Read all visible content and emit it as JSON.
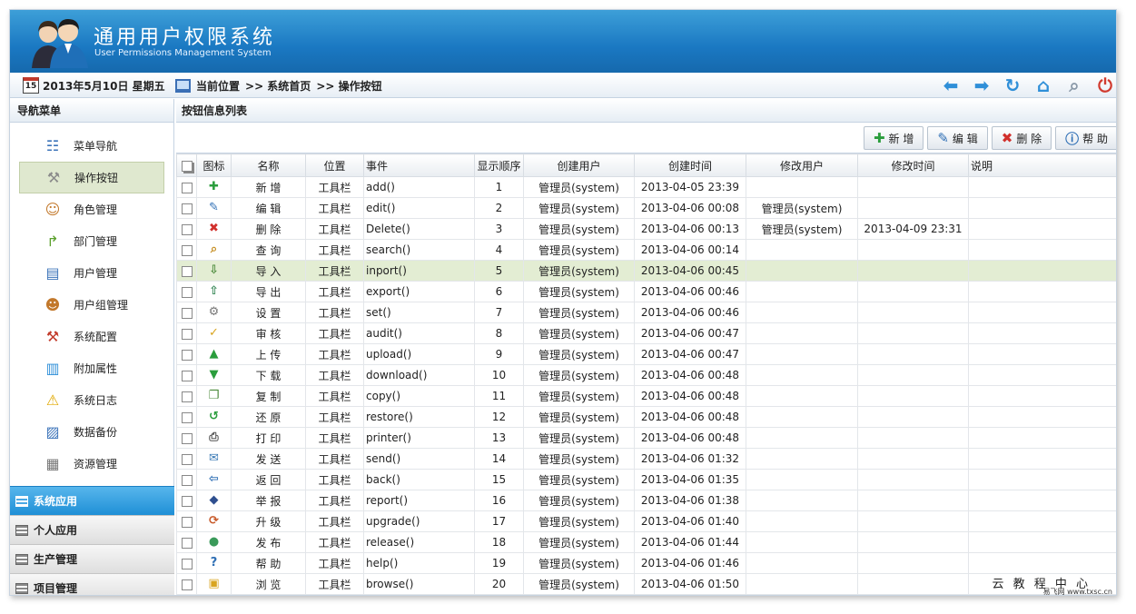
{
  "header": {
    "title": "通用用户权限系统",
    "subtitle": "User Permissions Management System"
  },
  "topbar": {
    "calendar_day": "15",
    "date": "2013年5月10日 星期五",
    "location_label": "当前位置",
    "crumb1": ">> 系统首页",
    "crumb2": ">> 操作按钮"
  },
  "sidebar": {
    "title": "导航菜单",
    "items": [
      {
        "label": "菜单导航",
        "icon": "sitemap-icon"
      },
      {
        "label": "操作按钮",
        "icon": "wrench-icon"
      },
      {
        "label": "角色管理",
        "icon": "users-icon"
      },
      {
        "label": "部门管理",
        "icon": "branch-icon"
      },
      {
        "label": "用户管理",
        "icon": "id-card-icon"
      },
      {
        "label": "用户组管理",
        "icon": "user-group-icon"
      },
      {
        "label": "系统配置",
        "icon": "tools-icon"
      },
      {
        "label": "附加属性",
        "icon": "book-icon"
      },
      {
        "label": "系统日志",
        "icon": "warning-icon"
      },
      {
        "label": "数据备份",
        "icon": "backup-icon"
      },
      {
        "label": "资源管理",
        "icon": "database-icon"
      }
    ],
    "groups": [
      "系统应用",
      "个人应用",
      "生产管理",
      "项目管理"
    ]
  },
  "main": {
    "title": "按钮信息列表",
    "buttons": {
      "add": "新 增",
      "edit": "编 辑",
      "delete": "删 除",
      "help": "帮 助"
    },
    "columns": [
      "图标",
      "名称",
      "位置",
      "事件",
      "显示顺序",
      "创建用户",
      "创建时间",
      "修改用户",
      "修改时间",
      "说明"
    ],
    "rows": [
      {
        "icon": "plus-icon",
        "name": "新 增",
        "pos": "工具栏",
        "event": "add()",
        "order": "1",
        "creator": "管理员(system)",
        "created": "2013-04-05 23:39",
        "modifier": "",
        "modified": ""
      },
      {
        "icon": "pencil-icon",
        "name": "编 辑",
        "pos": "工具栏",
        "event": "edit()",
        "order": "2",
        "creator": "管理员(system)",
        "created": "2013-04-06 00:08",
        "modifier": "管理员(system)",
        "modified": ""
      },
      {
        "icon": "cross-icon",
        "name": "删 除",
        "pos": "工具栏",
        "event": "Delete()",
        "order": "3",
        "creator": "管理员(system)",
        "created": "2013-04-06 00:13",
        "modifier": "管理员(system)",
        "modified": "2013-04-09 23:31"
      },
      {
        "icon": "magnifier-icon",
        "name": "查 询",
        "pos": "工具栏",
        "event": "search()",
        "order": "4",
        "creator": "管理员(system)",
        "created": "2013-04-06 00:14",
        "modifier": "",
        "modified": ""
      },
      {
        "icon": "import-icon",
        "name": "导 入",
        "pos": "工具栏",
        "event": "inport()",
        "order": "5",
        "creator": "管理员(system)",
        "created": "2013-04-06 00:45",
        "modifier": "",
        "modified": ""
      },
      {
        "icon": "export-icon",
        "name": "导 出",
        "pos": "工具栏",
        "event": "export()",
        "order": "6",
        "creator": "管理员(system)",
        "created": "2013-04-06 00:46",
        "modifier": "",
        "modified": ""
      },
      {
        "icon": "gear-icon",
        "name": "设 置",
        "pos": "工具栏",
        "event": "set()",
        "order": "7",
        "creator": "管理员(system)",
        "created": "2013-04-06 00:46",
        "modifier": "",
        "modified": ""
      },
      {
        "icon": "folder-check-icon",
        "name": "审 核",
        "pos": "工具栏",
        "event": "audit()",
        "order": "8",
        "creator": "管理员(system)",
        "created": "2013-04-06 00:47",
        "modifier": "",
        "modified": ""
      },
      {
        "icon": "upload-icon",
        "name": "上 传",
        "pos": "工具栏",
        "event": "upload()",
        "order": "9",
        "creator": "管理员(system)",
        "created": "2013-04-06 00:47",
        "modifier": "",
        "modified": ""
      },
      {
        "icon": "download-icon",
        "name": "下 载",
        "pos": "工具栏",
        "event": "download()",
        "order": "10",
        "creator": "管理员(system)",
        "created": "2013-04-06 00:48",
        "modifier": "",
        "modified": ""
      },
      {
        "icon": "copy-icon",
        "name": "复 制",
        "pos": "工具栏",
        "event": "copy()",
        "order": "11",
        "creator": "管理员(system)",
        "created": "2013-04-06 00:48",
        "modifier": "",
        "modified": ""
      },
      {
        "icon": "restore-icon",
        "name": "还 原",
        "pos": "工具栏",
        "event": "restore()",
        "order": "12",
        "creator": "管理员(system)",
        "created": "2013-04-06 00:48",
        "modifier": "",
        "modified": ""
      },
      {
        "icon": "printer-icon",
        "name": "打 印",
        "pos": "工具栏",
        "event": "printer()",
        "order": "13",
        "creator": "管理员(system)",
        "created": "2013-04-06 00:48",
        "modifier": "",
        "modified": ""
      },
      {
        "icon": "mail-icon",
        "name": "发 送",
        "pos": "工具栏",
        "event": "send()",
        "order": "14",
        "creator": "管理员(system)",
        "created": "2013-04-06 01:32",
        "modifier": "",
        "modified": ""
      },
      {
        "icon": "back-arrow-icon",
        "name": "返 回",
        "pos": "工具栏",
        "event": "back()",
        "order": "15",
        "creator": "管理员(system)",
        "created": "2013-04-06 01:35",
        "modifier": "",
        "modified": ""
      },
      {
        "icon": "report-icon",
        "name": "举 报",
        "pos": "工具栏",
        "event": "report()",
        "order": "16",
        "creator": "管理员(system)",
        "created": "2013-04-06 01:38",
        "modifier": "",
        "modified": ""
      },
      {
        "icon": "upgrade-icon",
        "name": "升 级",
        "pos": "工具栏",
        "event": "upgrade()",
        "order": "17",
        "creator": "管理员(system)",
        "created": "2013-04-06 01:40",
        "modifier": "",
        "modified": ""
      },
      {
        "icon": "globe-icon",
        "name": "发 布",
        "pos": "工具栏",
        "event": "release()",
        "order": "18",
        "creator": "管理员(system)",
        "created": "2013-04-06 01:44",
        "modifier": "",
        "modified": ""
      },
      {
        "icon": "help-icon",
        "name": "帮 助",
        "pos": "工具栏",
        "event": "help()",
        "order": "19",
        "creator": "管理员(system)",
        "created": "2013-04-06 01:46",
        "modifier": "",
        "modified": ""
      },
      {
        "icon": "browse-icon",
        "name": "浏 览",
        "pos": "工具栏",
        "event": "browse()",
        "order": "20",
        "creator": "管理员(system)",
        "created": "2013-04-06 01:50",
        "modifier": "",
        "modified": ""
      }
    ]
  },
  "footer": {
    "brand": "云 教 程 中 心",
    "url": "易飞网 www.txsc.cn"
  },
  "colors": {
    "header": "#1a78c2",
    "active_group": "#2b9be0",
    "highlight_row": "#e3edd3"
  }
}
